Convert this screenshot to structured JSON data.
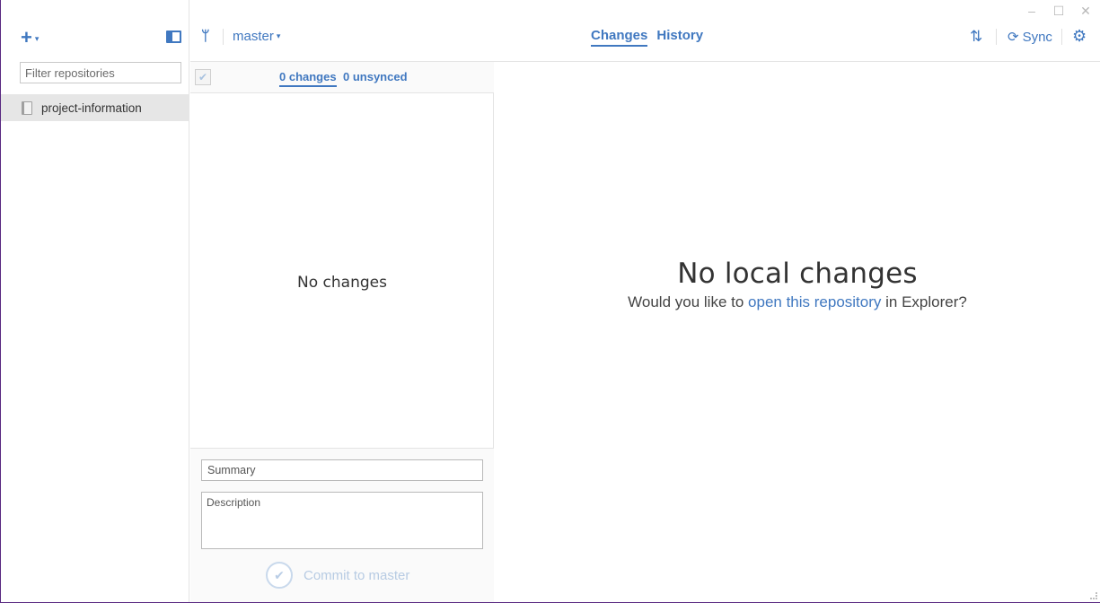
{
  "window": {
    "minimize_glyph": "–",
    "maximize_glyph": "☐",
    "close_glyph": "✕"
  },
  "sidebar": {
    "add_glyph": "+",
    "add_caret": "▾",
    "filter_placeholder": "Filter repositories",
    "repositories": [
      {
        "label": "project-information",
        "selected": true
      }
    ]
  },
  "toolbar": {
    "branch_icon": "branch-icon",
    "branch_glyph": "ᛘ",
    "branch_name": "master",
    "branch_caret": "▾",
    "tabs": [
      {
        "label": "Changes",
        "active": true
      },
      {
        "label": "History",
        "active": false
      }
    ],
    "pull_request_glyph": "⇅",
    "sync_glyph": "⟳",
    "sync_label": "Sync",
    "settings_glyph": "⚙"
  },
  "changes": {
    "select_all_glyph": "✔",
    "changes_tab": "0 changes",
    "unsynced_tab": "0 unsynced",
    "empty_text": "No changes",
    "summary_placeholder": "Summary",
    "description_placeholder": "Description",
    "commit_glyph": "✔",
    "commit_label": "Commit to master"
  },
  "main": {
    "title": "No local changes",
    "subtitle_prefix": "Would you like to ",
    "subtitle_link": "open this repository",
    "subtitle_suffix": " in Explorer?"
  },
  "colors": {
    "accent": "#4078c0",
    "border": "#e4e4e4",
    "selected_row": "#e6e6e6"
  }
}
